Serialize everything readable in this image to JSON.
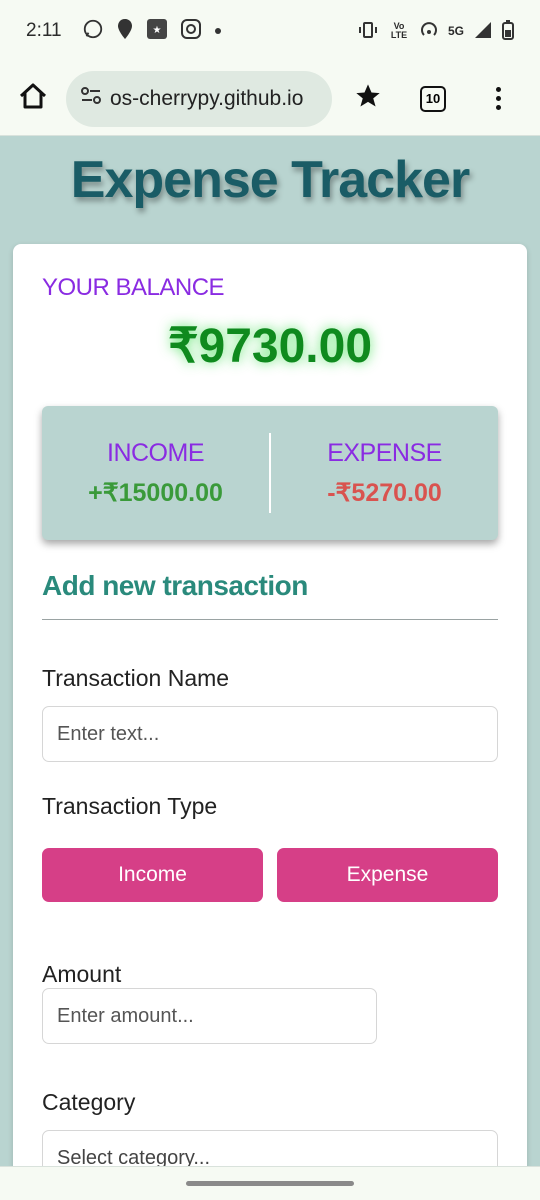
{
  "status_bar": {
    "time": "2:11",
    "network": "5G",
    "volte": "Vo LTE"
  },
  "browser": {
    "url": "os-cherrypy.github.io",
    "tab_count": "10"
  },
  "page": {
    "title": "Expense Tracker"
  },
  "balance": {
    "label": "YOUR BALANCE",
    "value": "₹9730.00"
  },
  "summary": {
    "income_label": "INCOME",
    "income_value": "+₹15000.00",
    "expense_label": "EXPENSE",
    "expense_value": "-₹5270.00"
  },
  "form": {
    "heading": "Add new transaction",
    "name_label": "Transaction Name",
    "name_placeholder": "Enter text...",
    "type_label": "Transaction Type",
    "income_button": "Income",
    "expense_button": "Expense",
    "amount_label": "Amount",
    "amount_placeholder": "Enter amount...",
    "category_label": "Category",
    "category_placeholder": "Select category..."
  },
  "colors": {
    "accent_purple": "#8a2be2",
    "balance_green": "#0f8a1e",
    "income_green": "#3a9a3a",
    "expense_red": "#d9534f",
    "button_pink": "#d63f87",
    "title_teal": "#1a5c66",
    "background": "#b9d4d0"
  }
}
